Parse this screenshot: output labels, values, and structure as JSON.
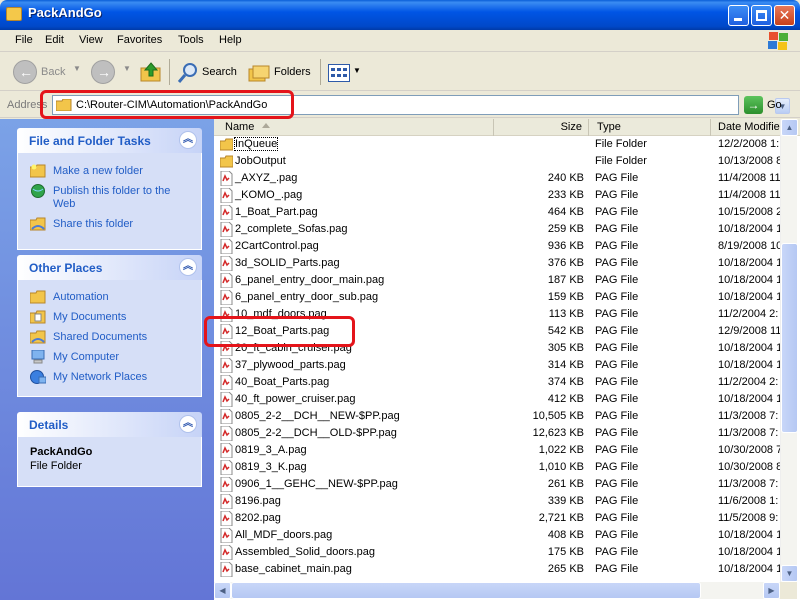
{
  "window": {
    "title": "PackAndGo"
  },
  "menu": [
    "File",
    "Edit",
    "View",
    "Favorites",
    "Tools",
    "Help"
  ],
  "toolbar": {
    "back": "Back",
    "search": "Search",
    "folders": "Folders"
  },
  "address": {
    "label": "Address",
    "path": "C:\\Router-CIM\\Automation\\PackAndGo",
    "go": "Go"
  },
  "tasks_panel": {
    "title": "File and Folder Tasks",
    "items": [
      "Make a new folder",
      "Publish this folder to the Web",
      "Share this folder"
    ]
  },
  "places_panel": {
    "title": "Other Places",
    "items": [
      "Automation",
      "My Documents",
      "Shared Documents",
      "My Computer",
      "My Network Places"
    ]
  },
  "details_panel": {
    "title": "Details",
    "name": "PackAndGo",
    "type": "File Folder"
  },
  "columns": {
    "name": "Name",
    "size": "Size",
    "type": "Type",
    "date": "Date Modifie"
  },
  "files": [
    {
      "name": "InQueue",
      "size": "",
      "type": "File Folder",
      "date": "12/2/2008 1:",
      "kind": "folder"
    },
    {
      "name": "JobOutput",
      "size": "",
      "type": "File Folder",
      "date": "10/13/2008 8",
      "kind": "folder"
    },
    {
      "name": "_AXYZ_.pag",
      "size": "240 KB",
      "type": "PAG File",
      "date": "11/4/2008 11",
      "kind": "file"
    },
    {
      "name": "_KOMO_.pag",
      "size": "233 KB",
      "type": "PAG File",
      "date": "11/4/2008 11",
      "kind": "file"
    },
    {
      "name": "1_Boat_Part.pag",
      "size": "464 KB",
      "type": "PAG File",
      "date": "10/15/2008 2",
      "kind": "file"
    },
    {
      "name": "2_complete_Sofas.pag",
      "size": "259 KB",
      "type": "PAG File",
      "date": "10/18/2004 1",
      "kind": "file"
    },
    {
      "name": "2CartControl.pag",
      "size": "936 KB",
      "type": "PAG File",
      "date": "8/19/2008 10",
      "kind": "file"
    },
    {
      "name": "3d_SOLID_Parts.pag",
      "size": "376 KB",
      "type": "PAG File",
      "date": "10/18/2004 1",
      "kind": "file"
    },
    {
      "name": "6_panel_entry_door_main.pag",
      "size": "187 KB",
      "type": "PAG File",
      "date": "10/18/2004 1",
      "kind": "file"
    },
    {
      "name": "6_panel_entry_door_sub.pag",
      "size": "159 KB",
      "type": "PAG File",
      "date": "10/18/2004 1",
      "kind": "file"
    },
    {
      "name": "10_mdf_doors.pag",
      "size": "113 KB",
      "type": "PAG File",
      "date": "11/2/2004 2:",
      "kind": "file"
    },
    {
      "name": "12_Boat_Parts.pag",
      "size": "542 KB",
      "type": "PAG File",
      "date": "12/9/2008 11",
      "kind": "file"
    },
    {
      "name": "20_ft_cabin_cruiser.pag",
      "size": "305 KB",
      "type": "PAG File",
      "date": "10/18/2004 1",
      "kind": "file"
    },
    {
      "name": "37_plywood_parts.pag",
      "size": "314 KB",
      "type": "PAG File",
      "date": "10/18/2004 1",
      "kind": "file"
    },
    {
      "name": "40_Boat_Parts.pag",
      "size": "374 KB",
      "type": "PAG File",
      "date": "11/2/2004 2:",
      "kind": "file"
    },
    {
      "name": "40_ft_power_cruiser.pag",
      "size": "412 KB",
      "type": "PAG File",
      "date": "10/18/2004 1",
      "kind": "file"
    },
    {
      "name": "0805_2-2__DCH__NEW-$PP.pag",
      "size": "10,505 KB",
      "type": "PAG File",
      "date": "11/3/2008 7:",
      "kind": "file"
    },
    {
      "name": "0805_2-2__DCH__OLD-$PP.pag",
      "size": "12,623 KB",
      "type": "PAG File",
      "date": "11/3/2008 7:",
      "kind": "file"
    },
    {
      "name": "0819_3_A.pag",
      "size": "1,022 KB",
      "type": "PAG File",
      "date": "10/30/2008 7",
      "kind": "file"
    },
    {
      "name": "0819_3_K.pag",
      "size": "1,010 KB",
      "type": "PAG File",
      "date": "10/30/2008 8",
      "kind": "file"
    },
    {
      "name": "0906_1__GEHC__NEW-$PP.pag",
      "size": "261 KB",
      "type": "PAG File",
      "date": "11/3/2008 7:",
      "kind": "file"
    },
    {
      "name": "8196.pag",
      "size": "339 KB",
      "type": "PAG File",
      "date": "11/6/2008 1:",
      "kind": "file"
    },
    {
      "name": "8202.pag",
      "size": "2,721 KB",
      "type": "PAG File",
      "date": "11/5/2008 9:",
      "kind": "file"
    },
    {
      "name": "All_MDF_doors.pag",
      "size": "408 KB",
      "type": "PAG File",
      "date": "10/18/2004 1",
      "kind": "file"
    },
    {
      "name": "Assembled_Solid_doors.pag",
      "size": "175 KB",
      "type": "PAG File",
      "date": "10/18/2004 1",
      "kind": "file"
    },
    {
      "name": "base_cabinet_main.pag",
      "size": "265 KB",
      "type": "PAG File",
      "date": "10/18/2004 1",
      "kind": "file"
    }
  ],
  "colors": {
    "taskpane_top": "#7ba2e7",
    "taskpane_bottom": "#6375d6",
    "link": "#215dc6",
    "highlight": "#e4141a"
  }
}
